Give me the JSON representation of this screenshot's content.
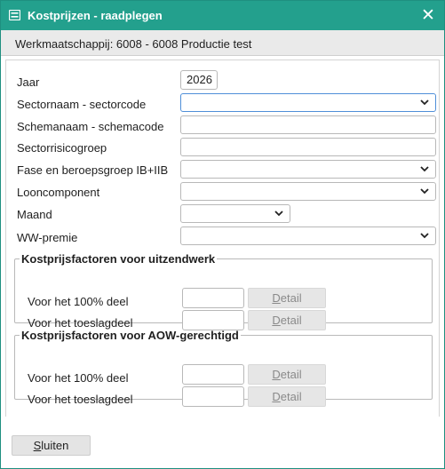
{
  "window": {
    "title": "Kostprijzen - raadplegen",
    "close_icon": "close-icon",
    "title_icon": "form-icon"
  },
  "subheader": {
    "text": "Werkmaatschappij:  6008  -  6008 Productie test"
  },
  "form": {
    "jaar_label": "Jaar",
    "jaar_value": "2026",
    "sector_label": "Sectornaam - sectorcode",
    "sector_value": "",
    "schema_label": "Schemanaam - schemacode",
    "schema_value": "",
    "risico_label": "Sectorrisicogroep",
    "risico_value": "",
    "fase_label": "Fase en beroepsgroep IB+IIB",
    "fase_value": "",
    "looncomp_label": "Looncomponent",
    "looncomp_value": "",
    "maand_label": "Maand",
    "maand_value": "",
    "ww_label": "WW-premie",
    "ww_value": ""
  },
  "uitzendwerk": {
    "legend": "Kostprijsfactoren voor uitzendwerk",
    "row1_label": "Voor het 100% deel",
    "row2_label": "Voor het toeslagdeel",
    "detail_first": "D",
    "detail_rest": "etail"
  },
  "aow": {
    "legend": "Kostprijsfactoren voor AOW-gerechtigd",
    "row1_label": "Voor het 100% deel",
    "row2_label": "Voor het toeslagdeel",
    "detail_first": "D",
    "detail_rest": "etail"
  },
  "footer": {
    "close_first": "S",
    "close_rest": "luiten"
  },
  "colors": {
    "titlebar": "#23a08d",
    "focus_border": "#4f8fd8"
  }
}
